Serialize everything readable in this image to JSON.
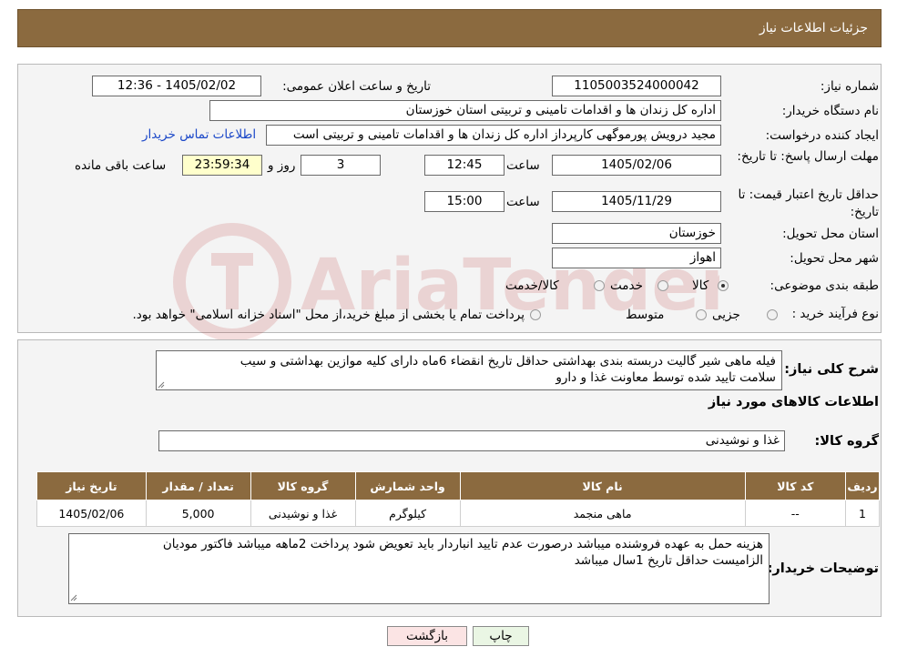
{
  "header": {
    "title": "جزئیات اطلاعات نیاز"
  },
  "watermark": {
    "text": "AriaTender.neT"
  },
  "form": {
    "need_number": {
      "label": "شماره نیاز:",
      "value": "1105003524000042"
    },
    "announce_datetime": {
      "label": "تاریخ و ساعت اعلان عمومی:",
      "value": "1405/02/02 - 12:36"
    },
    "buyer_org": {
      "label": "نام دستگاه خریدار:",
      "value": "اداره کل زندان ها و اقدامات تامینی و تربیتی استان خوزستان"
    },
    "requester": {
      "label": "ایجاد کننده درخواست:",
      "value": "مجید درویش پورموگهی کارپرداز اداره کل زندان ها و اقدامات تامینی و تربیتی است",
      "contact_link": "اطلاعات تماس خریدار"
    },
    "reply_deadline": {
      "label": "مهلت ارسال پاسخ: تا تاریخ:",
      "date": "1405/02/06",
      "time_label": "ساعت",
      "time": "12:45",
      "days": "3",
      "days_label": "روز و",
      "remaining": "23:59:34",
      "remaining_label": "ساعت باقی مانده"
    },
    "price_validity": {
      "label": "حداقل تاریخ اعتبار قیمت: تا تاریخ:",
      "date": "1405/11/29",
      "time_label": "ساعت",
      "time": "15:00"
    },
    "delivery_province": {
      "label": "استان محل تحویل:",
      "value": "خوزستان"
    },
    "delivery_city": {
      "label": "شهر محل تحویل:",
      "value": "اهواز"
    },
    "category": {
      "label": "طبقه بندی موضوعی:",
      "options": [
        "کالا",
        "خدمت",
        "کالا/خدمت"
      ],
      "selected": "کالا"
    },
    "purchase_type": {
      "label": "نوع فرآیند خرید :",
      "options": [
        "جزیی",
        "متوسط"
      ],
      "note": "پرداخت تمام یا بخشی از مبلغ خرید،از محل \"اسناد خزانه اسلامی\" خواهد بود."
    }
  },
  "description": {
    "label": "شرح کلی نیاز:",
    "line1": "فیله ماهی شیر گالیت دربسته بندی بهداشتی حداقل تاریخ انقضاء 6ماه  دارای کلیه موازین بهداشتی و سیب",
    "line2": "سلامت تایید شده توسط معاونت غذا و دارو"
  },
  "items": {
    "section_title": "اطلاعات کالاهای مورد نیاز",
    "group_label": "گروه کالا:",
    "group_value": "غذا و نوشیدنی",
    "headers": [
      "ردیف",
      "کد کالا",
      "نام کالا",
      "واحد شمارش",
      "گروه کالا",
      "تعداد / مقدار",
      "تاریخ نیاز"
    ],
    "rows": [
      [
        "1",
        "--",
        "ماهی منجمد",
        "کیلوگرم",
        "غذا و نوشیدنی",
        "5,000",
        "1405/02/06"
      ]
    ]
  },
  "buyer_notes": {
    "label": "توضیحات خریدار:",
    "line1": "هزینه حمل به عهده فروشنده میباشد درصورت عدم تایید انباردار باید تعویض شود پرداخت 2ماهه میباشد فاکتور مودیان",
    "line2": "الزامیست حداقل تاریخ 1سال میباشد"
  },
  "buttons": {
    "print": "چاپ",
    "back": "بازگشت"
  }
}
